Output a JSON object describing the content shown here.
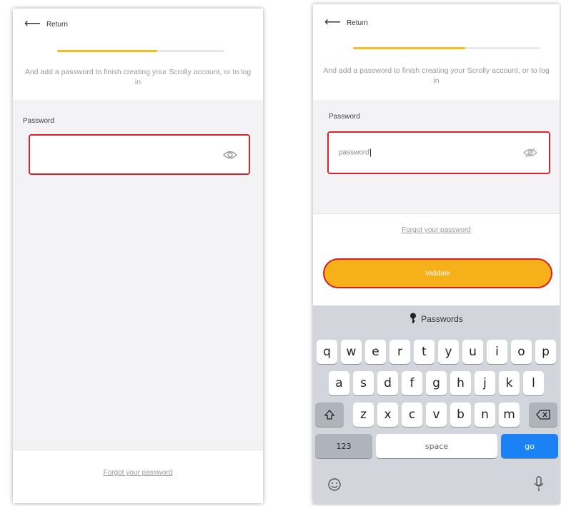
{
  "screen1": {
    "back_label": "Return",
    "subtitle": "And add a password to finish creating your Scrolly account, or to log in",
    "password_label": "Password",
    "password_value": "",
    "forgot_link": "Forgot your password",
    "progress": 0.6
  },
  "screen2": {
    "back_label": "Return",
    "subtitle": "And add a password to finish creating your Scrolly account, or to log in",
    "password_label": "Password",
    "password_value": "password",
    "forgot_link": "Forgot your password",
    "submit_label": "Validate",
    "progress": 0.6,
    "keyboard": {
      "suggestion": "Passwords",
      "row1": [
        "q",
        "w",
        "e",
        "r",
        "t",
        "y",
        "u",
        "i",
        "o",
        "p"
      ],
      "row2": [
        "a",
        "s",
        "d",
        "f",
        "g",
        "h",
        "j",
        "k",
        "l"
      ],
      "row3": [
        "z",
        "x",
        "c",
        "v",
        "b",
        "n",
        "m"
      ],
      "numbers_key": "123",
      "space_key": "space",
      "go_key": "go"
    }
  },
  "colors": {
    "accent": "#f5b01a",
    "highlight": "#e0202c",
    "progress": "#f0c020",
    "go_key": "#1a82f5"
  }
}
